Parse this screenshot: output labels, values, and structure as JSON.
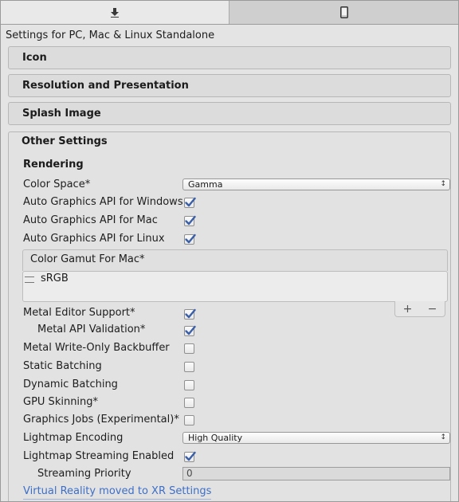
{
  "tabs": [
    {
      "icon": "download-icon"
    },
    {
      "icon": "mobile-device-icon"
    }
  ],
  "settings_title": "Settings for PC, Mac & Linux Standalone",
  "sections": {
    "icon": "Icon",
    "resolution": "Resolution and Presentation",
    "splash": "Splash Image",
    "other": "Other Settings"
  },
  "rendering": {
    "title": "Rendering",
    "color_space_label": "Color Space*",
    "color_space_value": "Gamma",
    "auto_graphics_windows": "Auto Graphics API  for Windows",
    "auto_graphics_mac": "Auto Graphics API  for Mac",
    "auto_graphics_linux": "Auto Graphics API  for Linux",
    "color_gamut_header": "Color Gamut For Mac*",
    "color_gamut_item": "sRGB",
    "plus_label": "+",
    "minus_label": "−",
    "metal_editor_support": "Metal Editor Support*",
    "metal_api_validation": "Metal API Validation*",
    "metal_write_only": "Metal Write-Only Backbuffer",
    "static_batching": "Static Batching",
    "dynamic_batching": "Dynamic Batching",
    "gpu_skinning": "GPU Skinning*",
    "graphics_jobs": "Graphics Jobs (Experimental)*",
    "lightmap_encoding_label": "Lightmap Encoding",
    "lightmap_encoding_value": "High Quality",
    "lightmap_streaming": "Lightmap Streaming Enabled",
    "streaming_priority_label": "Streaming Priority",
    "streaming_priority_value": "0",
    "vr_link": "Virtual Reality moved to XR Settings"
  },
  "checkboxes": {
    "auto_graphics_windows": true,
    "auto_graphics_mac": true,
    "auto_graphics_linux": true,
    "metal_editor_support": true,
    "metal_api_validation": true,
    "metal_write_only": false,
    "static_batching": false,
    "dynamic_batching": false,
    "gpu_skinning": false,
    "graphics_jobs": false,
    "lightmap_streaming": true
  },
  "colors": {
    "checkmark": "#3a5fa6",
    "link": "#3d6fc7"
  }
}
